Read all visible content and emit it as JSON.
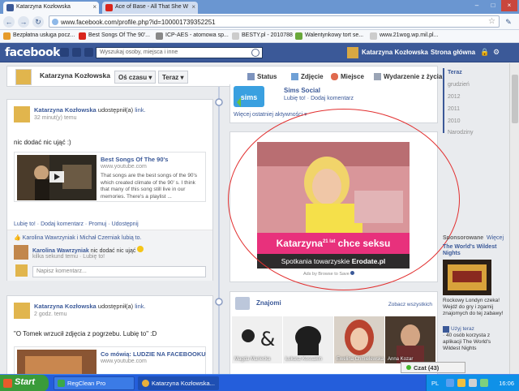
{
  "browser": {
    "tabs": [
      {
        "title": "Katarzyna Kozłowska",
        "active": true
      },
      {
        "title": "Ace of Base - All That She W",
        "active": false
      }
    ],
    "url": "www.facebook.com/profile.php?id=100001739352251",
    "bookmarks": [
      "Bezpłatna usługa pocz...",
      "Best Songs Of The 90'...",
      "ICP-AES - atomowa sp...",
      "BESTY.pl - 2010788",
      "Walentynkowy tort se...",
      "www.21wog.wp.mil.pl..."
    ]
  },
  "fb": {
    "logo": "facebook",
    "search_placeholder": "Wyszukaj osoby, miejsca i inne",
    "user_name": "Katarzyna Kozłowska",
    "home": "Strona główna"
  },
  "timeline": {
    "name": "Katarzyna Kozłowska",
    "over_time": "Oś czasu",
    "now": "Teraz",
    "actions": [
      "Status",
      "Zdjęcie",
      "Miejsce",
      "Wydarzenie z życia"
    ]
  },
  "post1": {
    "author": "Katarzyna Kozłowska",
    "shared": "udostępnił(a)",
    "link_word": "link.",
    "time": "32 minut(y) temu",
    "message": "nic dodać nic ująć :)",
    "card_title": "Best Songs Of The 90's",
    "card_source": "www.youtube.com",
    "card_desc": "That songs are the best songs of the 90's which created climate of the 90' s. I think that many of this song still live in our memories. There's a playlist ...",
    "actions": "Lubię to! · Dodaj komentarz · Promuj · Udostępnij",
    "likes": "Karolina Wawrzyniak i Michał Czerniak lubią to.",
    "comment_author": "Karolina Wawrzyniak",
    "comment_text": "nic dodać nic ująć",
    "comment_meta": "kilka sekund temu · Lubię to!",
    "comment_placeholder": "Napisz komentarz..."
  },
  "post2": {
    "author": "Katarzyna Kozłowska",
    "shared": "udostępnił(a)",
    "link_word": "link.",
    "time": "2 godz. temu",
    "message": "\"O Tomek wrzucił zdjęcia z pogrzebu. Lubię to\" :D",
    "card_title": "Co mówią: LUDZIE NA FACEBOOKU",
    "card_source": "www.youtube.com"
  },
  "sims": {
    "title": "Sims Social",
    "actions": "Lubię to! · Dodaj komentarz",
    "more": "Więcej ostatniej aktywności ▾"
  },
  "ad": {
    "headline": "Katarzyna",
    "age": "21 lat",
    "headline2": "chce seksu",
    "footer": "Spotkania towarzyskie",
    "footer_brand": "Erodate.pl",
    "by": "Ads by Browse to Save"
  },
  "friends": {
    "title": "Znajomi",
    "see_all": "Zobacz wszystkich",
    "items": [
      "Magda Mariecka",
      "Łukasz Kossakin",
      "Ewelina Chmielewska",
      "Anna Kozar"
    ]
  },
  "years": [
    "Teraz",
    "grudzień",
    "2012",
    "2011",
    "2010",
    "Narodziny"
  ],
  "sponsored": {
    "title": "Sponsorowane",
    "more": "Więcej",
    "ad_title": "The World's Wildest Nights",
    "ad_text": "Rockowy Londyn czeka! Wejdź do gry i zgarnij znajomych do tej zabawy!",
    "use_now": "Użyj teraz",
    "use_now_desc": "· 40 osób korzysta z aplikacji The World's Wildest Nights"
  },
  "chat": {
    "label": "Czat (43)"
  },
  "taskbar": {
    "start": "Start",
    "tasks": [
      "RegClean Pro",
      "Katarzyna Kozłowska..."
    ],
    "lang": "PL",
    "clock": "16:06"
  }
}
